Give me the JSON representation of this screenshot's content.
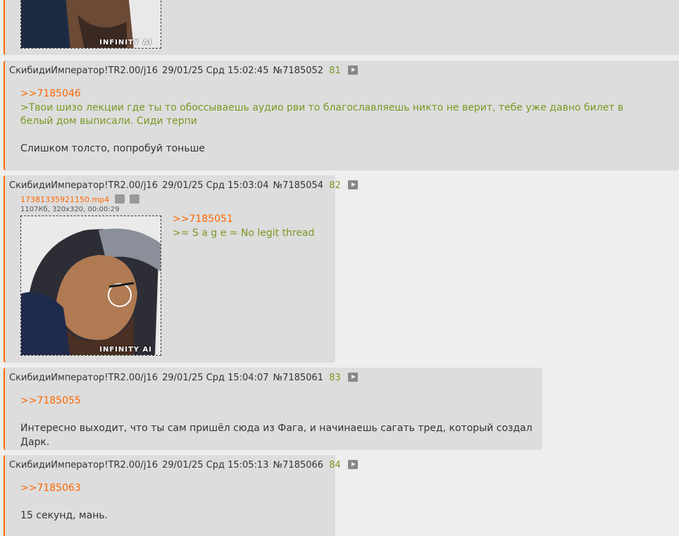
{
  "posts": [
    {
      "id": "p0",
      "media": {
        "watermark": "INFINITY AI"
      }
    },
    {
      "id": "p1",
      "author": "СкибидиИмператор!TR2.00/j16",
      "datetime": "29/01/25 Срд 15:02:45",
      "number": "№7185052",
      "index": "81",
      "reply_to": ">>7185046",
      "quote": ">Твои шизо лекции где ты то обоссываешь аудио рви то благославляешь никто не верит, тебе уже давно билет в белый дом выписали. Сиди терпи",
      "text": "Слишком толсто, попробуй тоньше"
    },
    {
      "id": "p2",
      "author": "СкибидиИмператор!TR2.00/j16",
      "datetime": "29/01/25 Срд 15:03:04",
      "number": "№7185054",
      "index": "82",
      "file_name": "17381335921150.mp4",
      "file_meta": "1107Кб, 320x320, 00:00:29",
      "media": {
        "watermark": "INFINITY AI"
      },
      "reply_to": ">>7185051",
      "quote": ">= S a g e = No legit thread"
    },
    {
      "id": "p3",
      "author": "СкибидиИмператор!TR2.00/j16",
      "datetime": "29/01/25 Срд 15:04:07",
      "number": "№7185061",
      "index": "83",
      "reply_to": ">>7185055",
      "text": "Интересно выходит, что ты сам пришёл сюда из Фага, и начинаешь сагать тред, который создал Дарк."
    },
    {
      "id": "p4",
      "author": "СкибидиИмператор!TR2.00/j16",
      "datetime": "29/01/25 Срд 15:05:13",
      "number": "№7185066",
      "index": "84",
      "reply_to": ">>7185063",
      "text": "15 секунд, мань."
    }
  ]
}
